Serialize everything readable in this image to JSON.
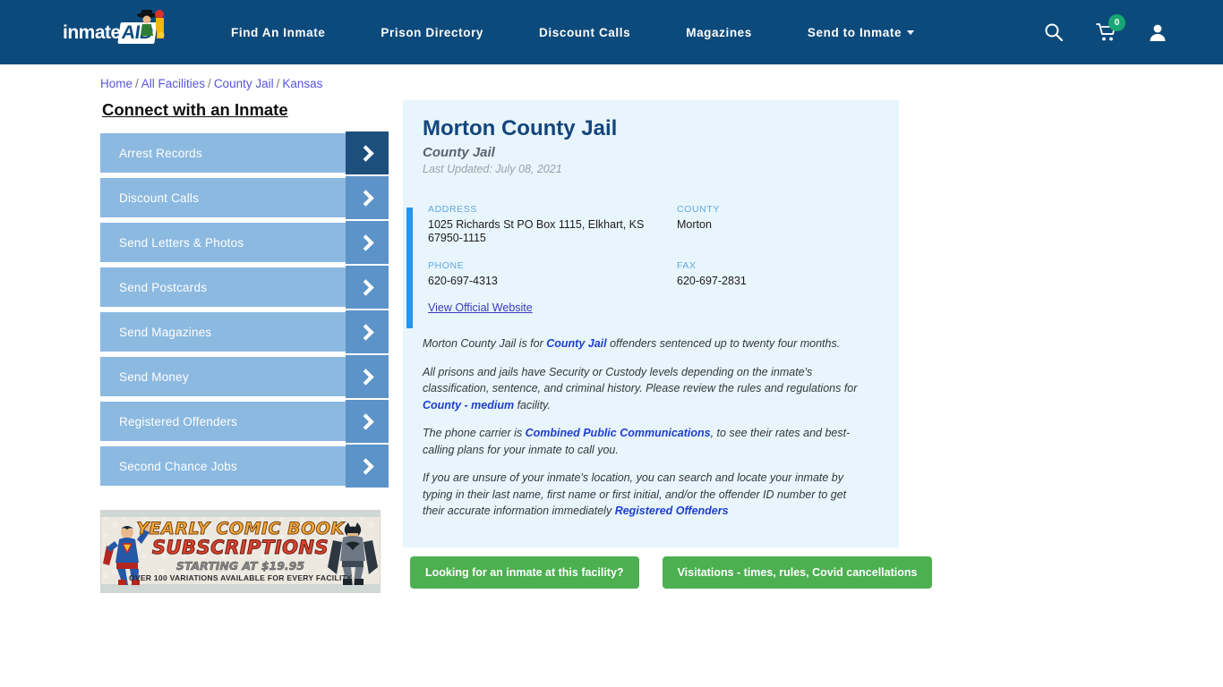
{
  "header": {
    "logo": {
      "text": "inmate",
      "badge": "AID",
      "icon": "inmateaid-logo"
    },
    "nav": [
      {
        "label": "Find An Inmate",
        "dropdown": false
      },
      {
        "label": "Prison Directory",
        "dropdown": false
      },
      {
        "label": "Discount Calls",
        "dropdown": false
      },
      {
        "label": "Magazines",
        "dropdown": false
      },
      {
        "label": "Send to Inmate",
        "dropdown": true
      }
    ],
    "icons": {
      "search": "search-icon",
      "cart": "cart-icon",
      "cart_count": "0",
      "account": "user-icon"
    },
    "bg_color": "#0c4a7c",
    "badge_color": "#17a673"
  },
  "breadcrumb": {
    "items": [
      "Home",
      "All Facilities",
      "County Jail",
      "Kansas"
    ],
    "separator": "/"
  },
  "sidebar": {
    "title": "Connect with an Inmate",
    "items": [
      {
        "label": "Arrest Records",
        "active": true
      },
      {
        "label": "Discount Calls",
        "active": false
      },
      {
        "label": "Send Letters & Photos",
        "active": false
      },
      {
        "label": "Send Postcards",
        "active": false
      },
      {
        "label": "Send Magazines",
        "active": false
      },
      {
        "label": "Send Money",
        "active": false
      },
      {
        "label": "Registered Offenders",
        "active": false
      },
      {
        "label": "Second Chance Jobs",
        "active": false
      }
    ]
  },
  "ad": {
    "line1": "YEARLY COMIC BOOK",
    "line2": "SUBSCRIPTIONS",
    "line3": "STARTING AT $19.95",
    "line4": "OVER 100 VARIATIONS AVAILABLE FOR EVERY FACILITY"
  },
  "facility": {
    "name": "Morton County Jail",
    "type": "County Jail",
    "last_updated": "Last Updated: July 08, 2021",
    "fields": {
      "address_label": "ADDRESS",
      "address_value": "1025 Richards St PO Box 1115, Elkhart, KS 67950-1115",
      "county_label": "COUNTY",
      "county_value": "Morton",
      "phone_label": "PHONE",
      "phone_value": "620-697-4313",
      "fax_label": "FAX",
      "fax_value": "620-697-2831"
    },
    "website_link": "View Official Website"
  },
  "description": {
    "p1_a": "Morton County Jail is for ",
    "p1_link": "County Jail",
    "p1_b": " offenders sentenced up to twenty four months.",
    "p2_a": "All prisons and jails have Security or Custody levels depending on the inmate's classification, sentence, and criminal history. Please review the rules and regulations for ",
    "p2_link": "County - medium",
    "p2_b": " facility.",
    "p3_a": "The phone carrier is ",
    "p3_link": "Combined Public Communications",
    "p3_b": ", to see their rates and best-calling plans for your inmate to call you.",
    "p4_a": "If you are unsure of your inmate's location, you can search and locate your inmate by typing in their last name, first name or first initial, and/or the offender ID number to get their accurate information immediately ",
    "p4_link": "Registered Offenders"
  },
  "cta": {
    "primary": "Looking for an inmate at this facility?",
    "secondary": "Visitations - times, rules, Covid cancellations",
    "color": "#4caf50"
  }
}
